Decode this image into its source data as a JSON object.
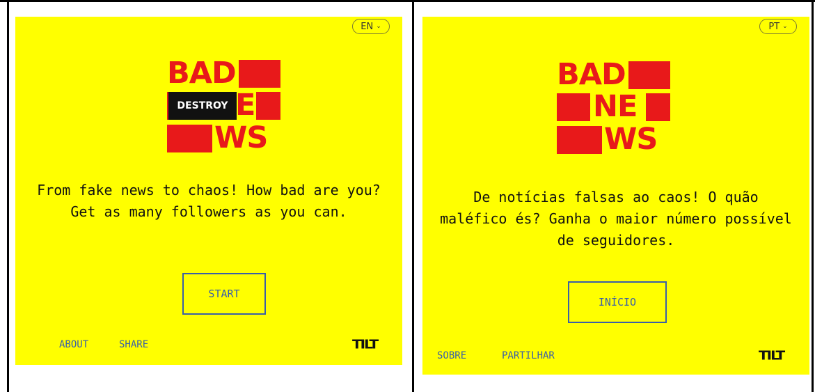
{
  "colors": {
    "background": "#ffff00",
    "logo_red": "#e8191a",
    "link_blue": "#3a5fa8"
  },
  "left_panel": {
    "language": "EN",
    "language_chevron": "chevron-down-icon",
    "logo": {
      "line1": "BAD",
      "line2": "E",
      "line3": "WS",
      "overlay": "DESTROY"
    },
    "tagline": "From fake news to chaos! How bad are you? Get as many followers as you can.",
    "start_label": "START",
    "about_label": "ABOUT",
    "share_label": "SHARE",
    "brand": "TILT"
  },
  "right_panel": {
    "language": "PT",
    "language_chevron": "chevron-down-icon",
    "logo": {
      "line1": "BAD",
      "line2": "NE",
      "line3": "WS"
    },
    "tagline": "De notícias falsas ao caos! O quão maléfico és? Ganha o maior número possível de seguidores.",
    "start_label": "INÍCIO",
    "about_label": "SOBRE",
    "share_label": "PARTILHAR",
    "brand": "TILT"
  }
}
